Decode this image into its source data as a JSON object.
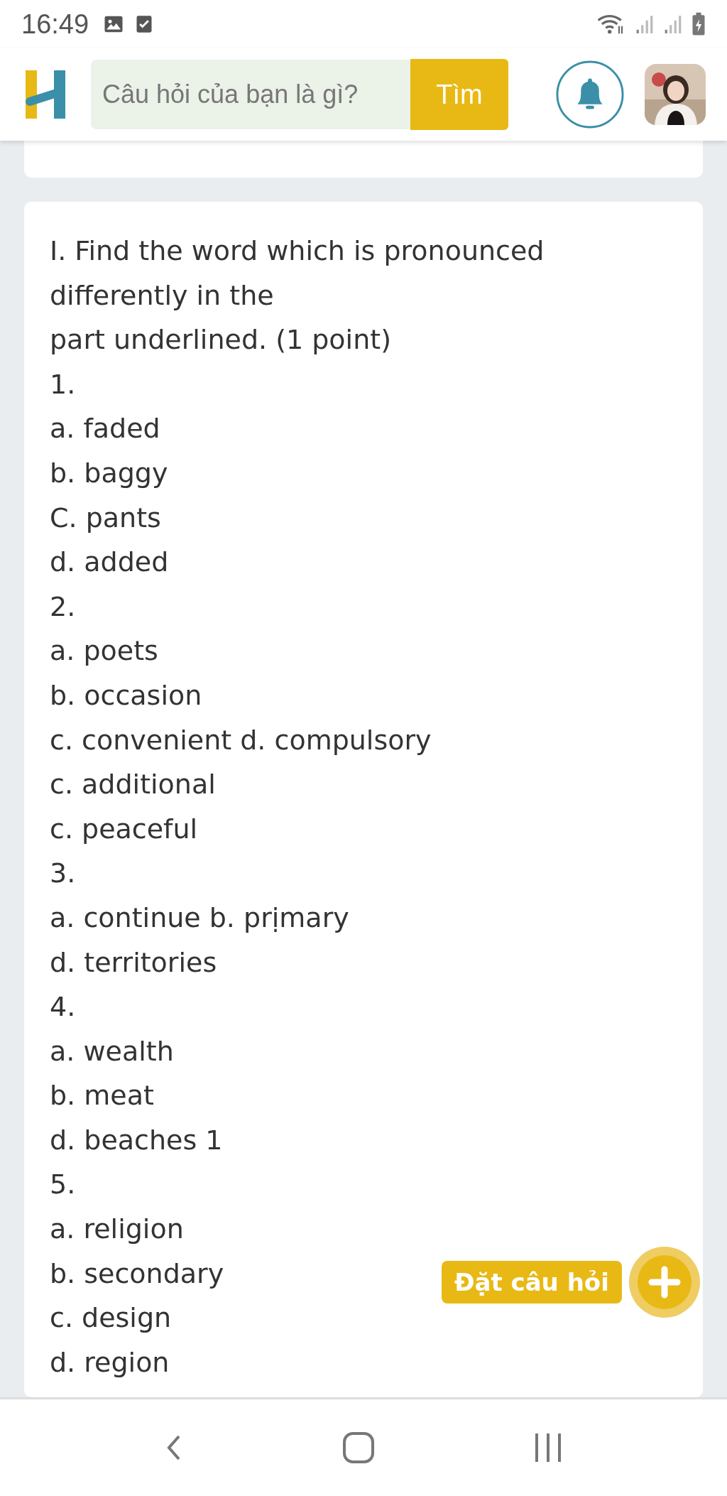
{
  "status_bar": {
    "time": "16:49"
  },
  "header": {
    "search": {
      "placeholder": "Câu hỏi của bạn là gì?"
    },
    "search_button": "Tìm"
  },
  "question": {
    "lines": [
      "I. Find the word which is pronounced",
      "differently in the",
      "part underlined. (1 point)",
      "1.",
      "a. faded",
      "b. baggy",
      "C. pants",
      "d. added",
      "2.",
      "a. poets",
      "b. occasion",
      "c. convenient d. compulsory",
      "c. additional",
      "c. peaceful",
      "3.",
      "a. continue b. prịmary",
      "d. territories",
      "4.",
      "a. wealth",
      "b. meat",
      "d. beaches 1",
      "5.",
      "a. religion",
      "b. secondary",
      "c. design",
      "d. region"
    ]
  },
  "ask_button": {
    "label": "Đặt câu hỏi"
  }
}
